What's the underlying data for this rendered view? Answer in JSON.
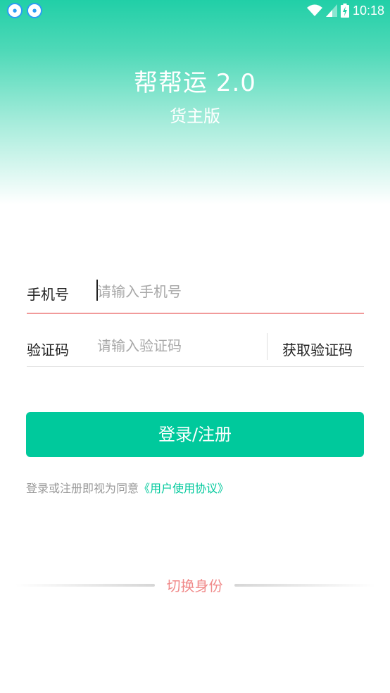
{
  "statusbar": {
    "left_icons": [
      "app-notification-icon",
      "app-notification-icon"
    ],
    "right_icons": [
      "wifi-icon",
      "signal-icon",
      "battery-charging-icon"
    ],
    "time": "10:18"
  },
  "header": {
    "title": "帮帮运 2.0",
    "subtitle": "货主版"
  },
  "form": {
    "phone": {
      "label": "手机号",
      "value": "",
      "placeholder": "请输入手机号"
    },
    "code": {
      "label": "验证码",
      "value": "",
      "placeholder": "请输入验证码",
      "get_code_label": "获取验证码"
    }
  },
  "login": {
    "label": "登录/注册"
  },
  "agreement": {
    "prefix": "登录或注册即视为同意",
    "link": "《用户使用协议》"
  },
  "switch_identity": {
    "label": "切换身份"
  },
  "colors": {
    "accent": "#00c99c",
    "header_gradient_top": "#21cfa7",
    "error_underline": "#f19a9a",
    "switch_text": "#f08a8a"
  }
}
